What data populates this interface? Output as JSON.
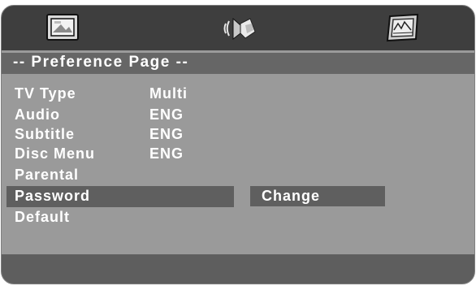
{
  "tabs": [
    {
      "icon": "general-setup-icon",
      "active": false
    },
    {
      "icon": "audio-setup-icon",
      "active": false
    },
    {
      "icon": "preference-setup-icon",
      "active": true
    }
  ],
  "page": {
    "title": "-- Preference Page --"
  },
  "menu": {
    "items": [
      {
        "label": "TV Type",
        "value": "Multi"
      },
      {
        "label": "Audio",
        "value": "ENG"
      },
      {
        "label": "Subtitle",
        "value": "ENG"
      },
      {
        "label": "Disc Menu",
        "value": "ENG"
      },
      {
        "label": "Parental",
        "value": ""
      },
      {
        "label": "Password",
        "value": "",
        "selected": true
      },
      {
        "label": "Default",
        "value": ""
      }
    ],
    "submenu_option": "Change"
  },
  "colors": {
    "background": "#9a9a9a",
    "icon_bar": "#3e3e3e",
    "title_bar": "#666666",
    "highlight": "#5f5f5f",
    "text": "#ffffff"
  }
}
